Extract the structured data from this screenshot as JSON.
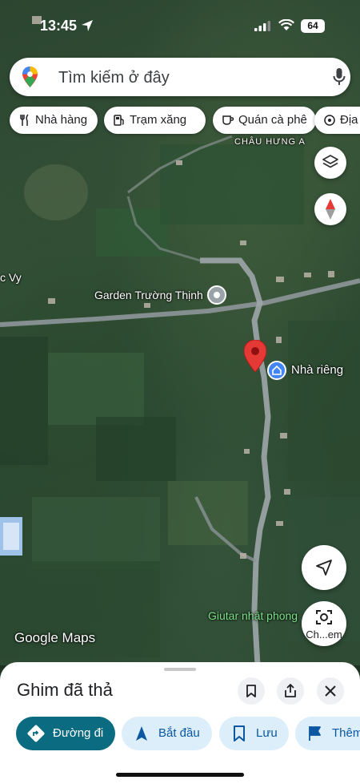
{
  "status_bar": {
    "time": "13:45",
    "battery": "64"
  },
  "search": {
    "placeholder": "Tìm kiếm ở đây"
  },
  "chips": [
    {
      "label": "Nhà hàng",
      "icon": "fork-knife-icon"
    },
    {
      "label": "Trạm xăng",
      "icon": "gas-pump-icon"
    },
    {
      "label": "Quán cà phê",
      "icon": "coffee-cup-icon"
    },
    {
      "label": "Địa",
      "icon": "landmark-icon"
    }
  ],
  "map": {
    "labels": {
      "area": "CHÂU HƯNG A",
      "place_left": "c Vy",
      "garden": "Garden Trường Thịnh",
      "home": "Nhà riêng",
      "guitar": "Giutar nhật phong",
      "attribution": "Google Maps"
    },
    "compass_icon": "compass-icon",
    "layers_icon": "layers-icon",
    "location_icon": "navigation-arrow-icon",
    "lens_label": "Ch...em",
    "pin_color": "#e53935"
  },
  "sheet": {
    "title": "Ghim đã thả",
    "actions": [
      {
        "label": "Đường đi",
        "icon": "directions-icon"
      },
      {
        "label": "Bắt đầu",
        "icon": "navigate-icon"
      },
      {
        "label": "Lưu",
        "icon": "bookmark-icon"
      },
      {
        "label": "Thêm",
        "icon": "flag-icon"
      }
    ]
  },
  "colors": {
    "primary": "#0b6b80",
    "action_bg": "#dbeef9",
    "action_text": "#0b57a1"
  }
}
